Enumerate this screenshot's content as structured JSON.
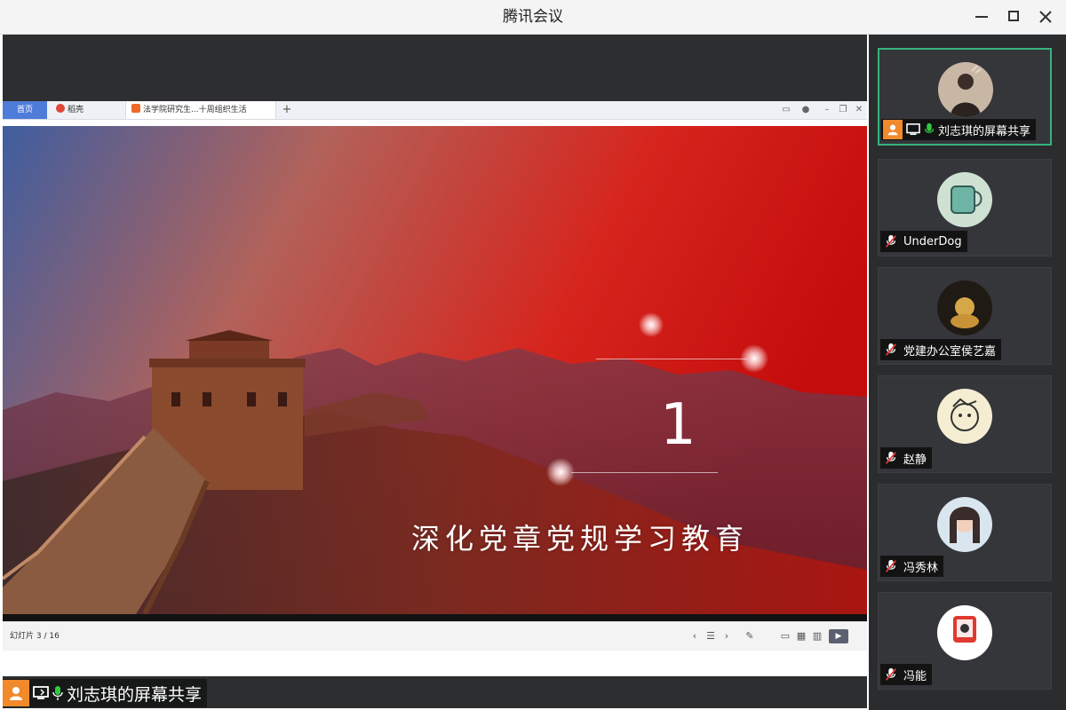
{
  "window": {
    "title": "腾讯会议"
  },
  "shared_screen": {
    "browser": {
      "tabs": [
        {
          "label": "首页"
        },
        {
          "label": "稻壳"
        },
        {
          "label": "法学院研究生...十周组织生活"
        }
      ]
    },
    "slide": {
      "number": "1",
      "title": "深化党章党规学习教育"
    },
    "status": {
      "page_indicator": "幻灯片 3 / 16"
    }
  },
  "presenter_label": {
    "name": "刘志琪的屏幕共享"
  },
  "participants": [
    {
      "name": "刘志琪的屏幕共享",
      "muted": false,
      "sharing": true
    },
    {
      "name": "UnderDog",
      "muted": true
    },
    {
      "name": "党建办公室侯艺嘉",
      "muted": true
    },
    {
      "name": "赵静",
      "muted": true
    },
    {
      "name": "冯秀林",
      "muted": true
    },
    {
      "name": "冯能",
      "muted": true
    }
  ],
  "colors": {
    "accent_active": "#36b37e",
    "avatar_orange": "#f08a2a",
    "mic_green": "#2ecc40",
    "slide_red": "#d01b1b"
  }
}
